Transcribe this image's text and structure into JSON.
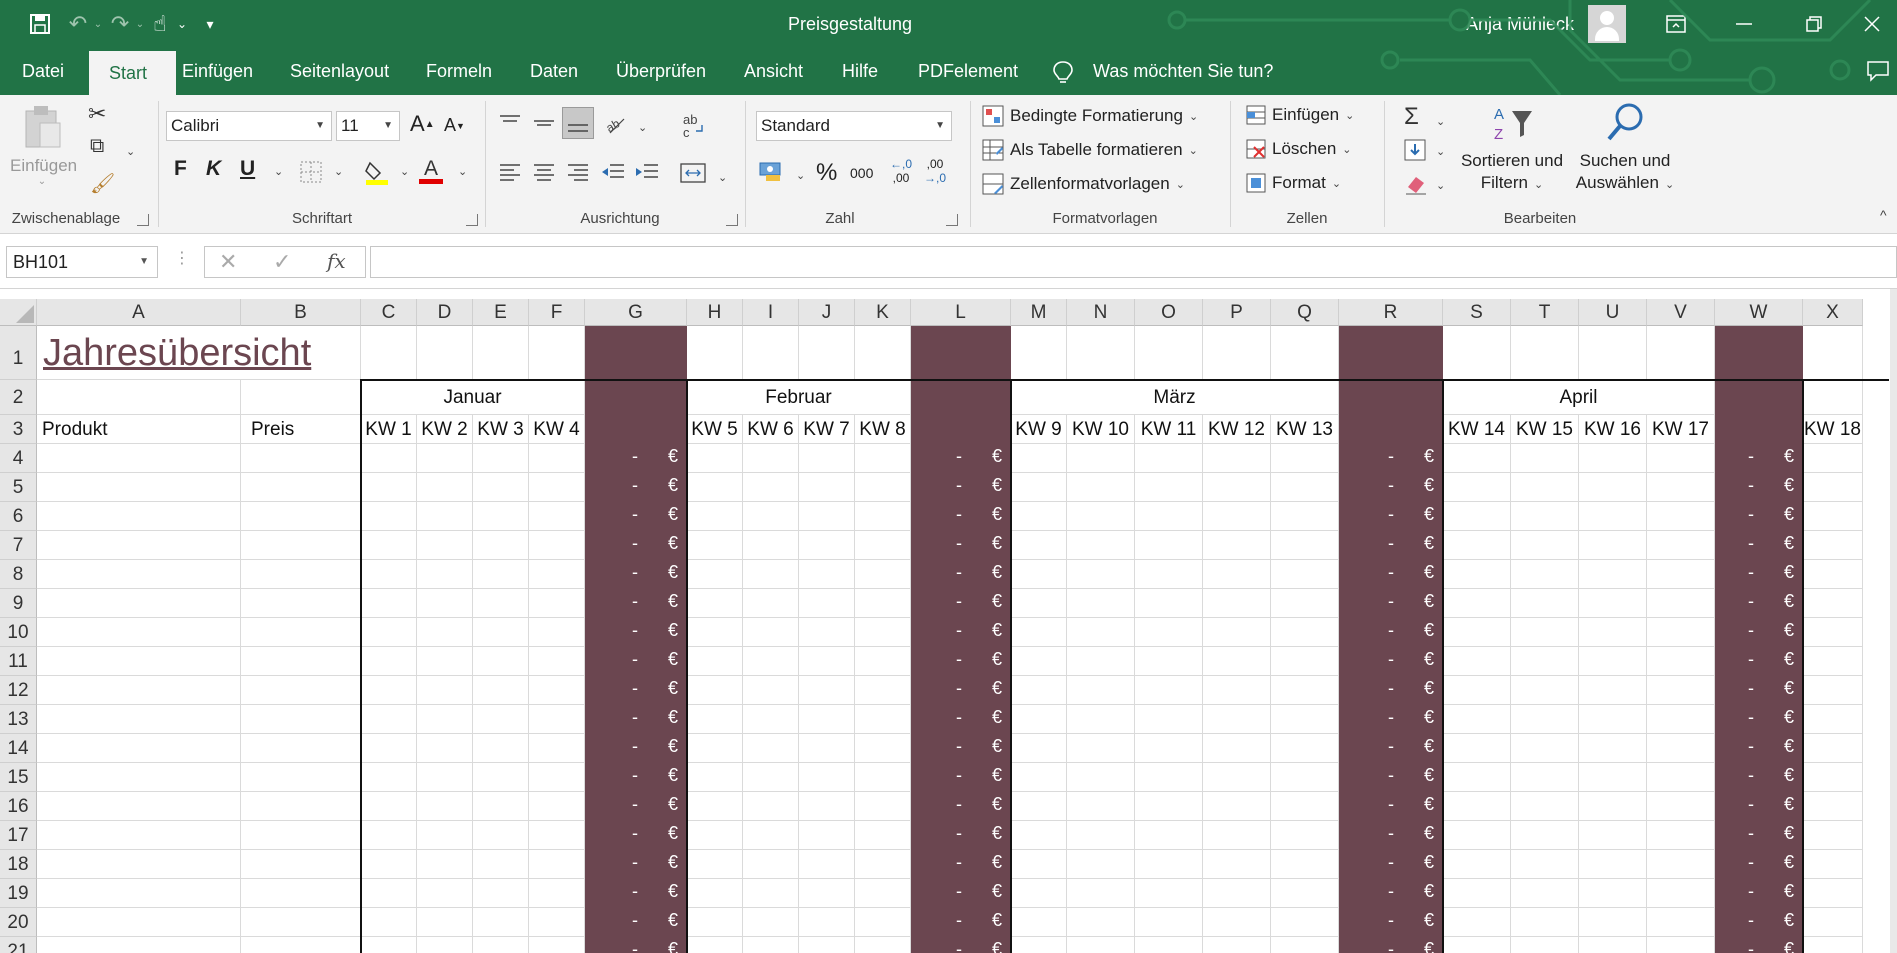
{
  "title_bar": {
    "title": "Preisgestaltung",
    "user": "Anja Mühleck",
    "quick_access": [
      "save-icon",
      "undo-icon",
      "redo-icon",
      "touch-mode-icon",
      "customize-icon"
    ]
  },
  "tabs": [
    "Datei",
    "Start",
    "Einfügen",
    "Seitenlayout",
    "Formeln",
    "Daten",
    "Überprüfen",
    "Ansicht",
    "Hilfe",
    "PDFelement"
  ],
  "active_tab": "Start",
  "tell_me": "Was möchten Sie tun?",
  "ribbon": {
    "clipboard": {
      "paste": "Einfügen",
      "label": "Zwischenablage"
    },
    "font": {
      "name": "Calibri",
      "size": "11",
      "bold": "F",
      "italic": "K",
      "underline": "U",
      "label": "Schriftart",
      "grow": "A",
      "shrink": "A",
      "color_letter": "A"
    },
    "alignment": {
      "label": "Ausrichtung"
    },
    "number": {
      "format": "Standard",
      "percent": "%",
      "thousands": "000",
      "inc_decimal": ",00",
      "dec_decimal": ",0",
      "label": "Zahl"
    },
    "styles": {
      "conditional": "Bedingte Formatierung",
      "as_table": "Als Tabelle formatieren",
      "cell_styles": "Zellenformatvorlagen",
      "label": "Formatvorlagen"
    },
    "cells": {
      "insert": "Einfügen",
      "delete": "Löschen",
      "format": "Format",
      "label": "Zellen"
    },
    "editing": {
      "sort_line1": "Sortieren und",
      "sort_line2": "Filtern",
      "find_line1": "Suchen und",
      "find_line2": "Auswählen",
      "label": "Bearbeiten"
    }
  },
  "formula_bar": {
    "name_box": "BH101",
    "formula": ""
  },
  "sheet": {
    "columns": [
      "A",
      "B",
      "C",
      "D",
      "E",
      "F",
      "G",
      "H",
      "I",
      "J",
      "K",
      "L",
      "M",
      "N",
      "O",
      "P",
      "Q",
      "R",
      "S",
      "T",
      "U",
      "V",
      "W",
      "X"
    ],
    "rows": [
      "1",
      "2",
      "3",
      "4",
      "5",
      "6",
      "7",
      "8",
      "9",
      "10",
      "11",
      "12",
      "13",
      "14",
      "15",
      "16",
      "17",
      "18",
      "19",
      "20",
      "21"
    ],
    "title": "Jahresübersicht",
    "header_produkt": "Produkt",
    "header_preis": "Preis",
    "months": [
      "Januar",
      "Februar",
      "März",
      "April"
    ],
    "weeks": [
      "KW 1",
      "KW 2",
      "KW 3",
      "KW 4",
      "KW 5",
      "KW 6",
      "KW 7",
      "KW 8",
      "KW 9",
      "KW 10",
      "KW 11",
      "KW 12",
      "KW 13",
      "KW 14",
      "KW 15",
      "KW 16",
      "KW 17",
      "KW 18"
    ],
    "sum_dash": "-",
    "sum_currency": "€",
    "sum_color": "#6b4650",
    "title_color": "#6b4650"
  }
}
